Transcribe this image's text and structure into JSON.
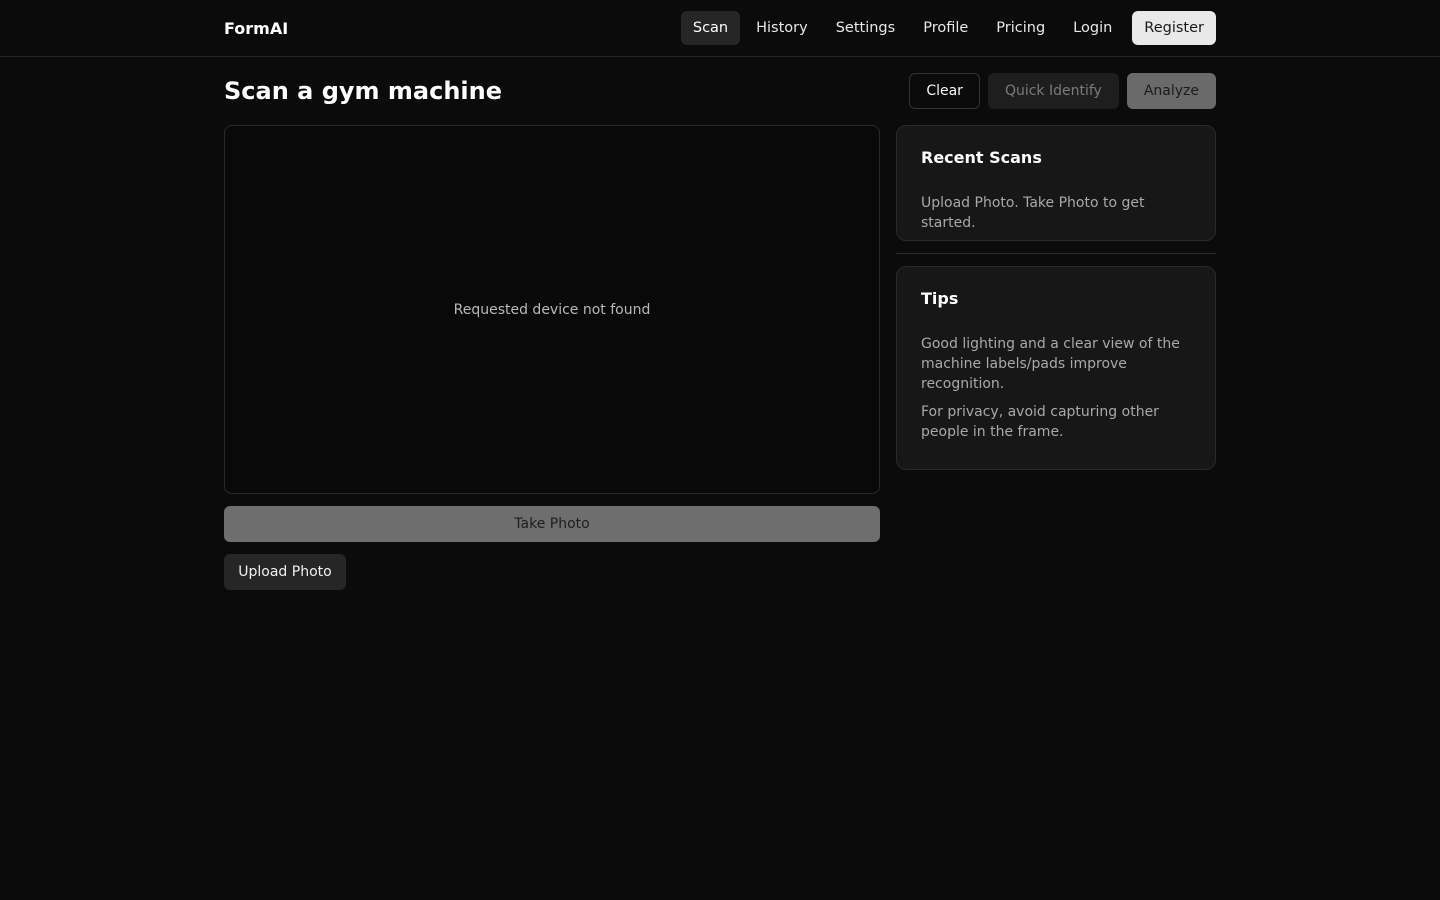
{
  "app": {
    "brand": "FormAI"
  },
  "nav": {
    "items": [
      {
        "label": "Scan",
        "active": true
      },
      {
        "label": "History"
      },
      {
        "label": "Settings"
      },
      {
        "label": "Profile"
      },
      {
        "label": "Pricing"
      },
      {
        "label": "Login"
      }
    ],
    "register_label": "Register"
  },
  "page": {
    "title": "Scan a gym machine",
    "actions": {
      "clear_label": "Clear",
      "quick_identify_label": "Quick Identify",
      "analyze_label": "Analyze"
    }
  },
  "camera": {
    "message": "Requested device not found",
    "take_photo_label": "Take Photo",
    "upload_photo_label": "Upload Photo"
  },
  "recent_scans": {
    "title": "Recent Scans",
    "empty_text": "Upload Photo. Take Photo to get started."
  },
  "tips": {
    "title": "Tips",
    "items": [
      "Good lighting and a clear view of the machine labels/pads improve recognition.",
      "For privacy, avoid capturing other people in the frame."
    ]
  },
  "colors": {
    "background": "#0b0b0b",
    "card": "#171717",
    "border": "#2a2a2a",
    "active_nav": "#262626",
    "disabled_button": "#6e6e6e"
  }
}
